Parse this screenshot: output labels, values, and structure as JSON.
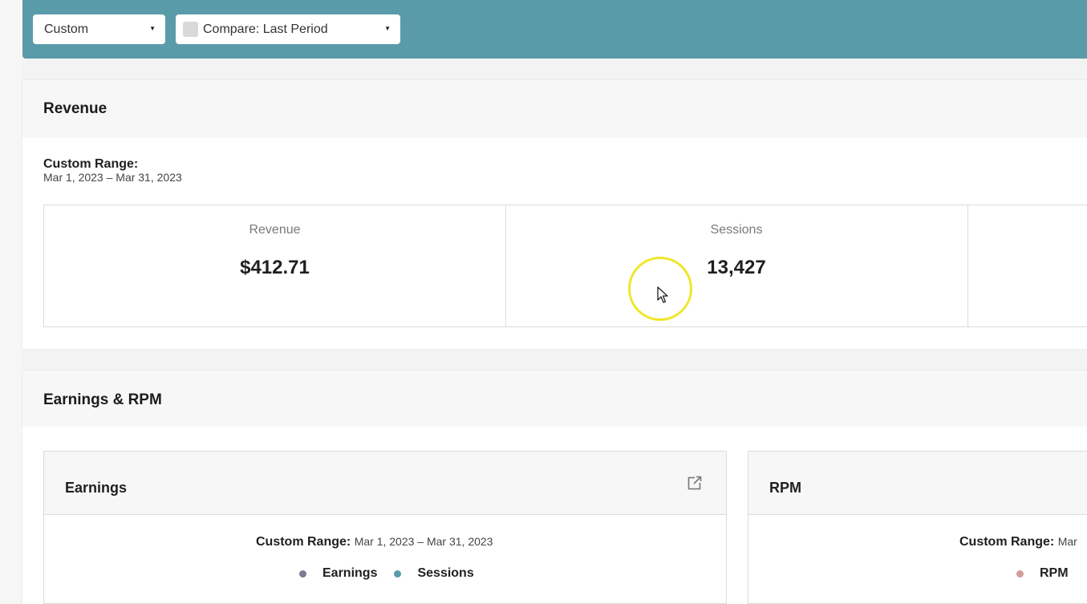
{
  "toolbar": {
    "range_select": "Custom",
    "compare_select": "Compare: Last Period",
    "compare_checked": false
  },
  "revenue_section": {
    "title": "Revenue",
    "range_label": "Custom Range:",
    "range_dates": "Mar 1, 2023 – Mar 31, 2023",
    "metrics": [
      {
        "label": "Revenue",
        "value": "$412.71"
      },
      {
        "label": "Sessions",
        "value": "13,427"
      }
    ]
  },
  "earnings_section": {
    "title": "Earnings & RPM",
    "earnings_card": {
      "title": "Earnings",
      "range_label": "Custom Range:",
      "range_dates": "Mar 1, 2023 – Mar 31, 2023",
      "legend": [
        {
          "label": "Earnings",
          "color": "#7d7a92"
        },
        {
          "label": "Sessions",
          "color": "#5a9ba9"
        }
      ]
    },
    "rpm_card": {
      "title": "RPM",
      "range_label": "Custom Range:",
      "range_dates": "Mar",
      "legend": [
        {
          "label": "RPM",
          "color": "#d49a9a"
        }
      ]
    }
  },
  "colors": {
    "accent": "#5a9ba9",
    "cursor_highlight": "#f0e62a"
  }
}
